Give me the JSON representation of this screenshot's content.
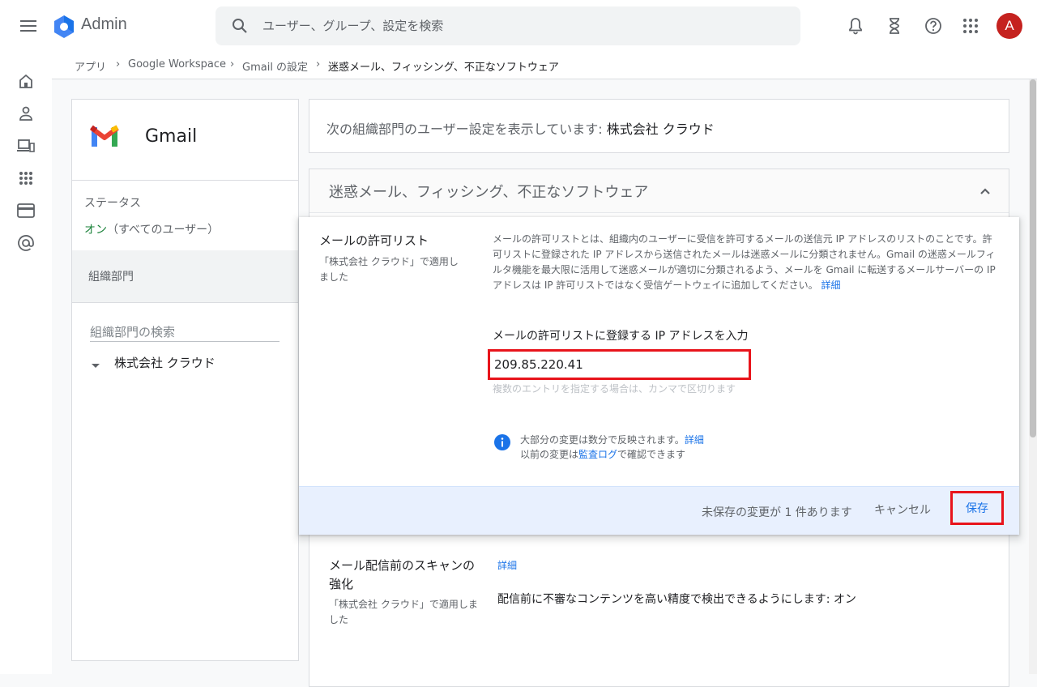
{
  "header": {
    "app_title": "Admin",
    "search_placeholder": "ユーザー、グループ、設定を検索",
    "avatar_letter": "A"
  },
  "breadcrumb": {
    "items": [
      "アプリ",
      "Google Workspace",
      "Gmail の設定",
      "迷惑メール、フィッシング、不正なソフトウェア"
    ]
  },
  "left_panel": {
    "app_name": "Gmail",
    "status_label": "ステータス",
    "status_on": "オン",
    "status_scope": "（すべてのユーザー）",
    "ou_header": "組織部門",
    "ou_search_placeholder": "組織部門の検索",
    "ou_item": "株式会社 クラウド"
  },
  "info_bar": {
    "prefix": "次の組織部門のユーザー設定を表示しています: ",
    "org": "株式会社 クラウド"
  },
  "section": {
    "title": "迷惑メール、フィッシング、不正なソフトウェア"
  },
  "dialog": {
    "setting_title": "メールの許可リスト",
    "applied_line1": "「株式会社 クラウド」で適用し",
    "applied_line2": "ました",
    "description": "メールの許可リストとは、組織内のユーザーに受信を許可するメールの送信元 IP アドレスのリストのことです。許可リストに登録された IP アドレスから送信されたメールは迷惑メールに分類されません。Gmail の迷惑メールフィルタ機能を最大限に活用して迷惑メールが適切に分類されるよう、メールを Gmail に転送するメールサーバーの IP アドレスは IP 許可リストではなく受信ゲートウェイに追加してください。",
    "description_link": "詳細",
    "field_label": "メールの許可リストに登録する IP アドレスを入力",
    "ip_value": "209.85.220.41",
    "field_hint": "複数のエントリを指定する場合は、カンマで区切ります",
    "info_line1": "大部分の変更は数分で反映されます。",
    "info_line1_link": "詳細",
    "info_line2_prefix": "以前の変更は",
    "info_line2_link": "監査ログ",
    "info_line2_suffix": "で確認できます",
    "unsaved": "未保存の変更が 1 件あります",
    "cancel": "キャンセル",
    "save": "保存"
  },
  "setting2": {
    "title": "メール配信前のスキャンの強化",
    "applied": "「株式会社 クラウド」で適用しました",
    "link": "詳細",
    "value": "配信前に不審なコンテンツを高い精度で検出できるようにします: オン"
  },
  "colors": {
    "accent_blue": "#1a73e8",
    "status_green": "#188038",
    "highlight_red": "#e8141b",
    "avatar_red": "#c5221f"
  }
}
